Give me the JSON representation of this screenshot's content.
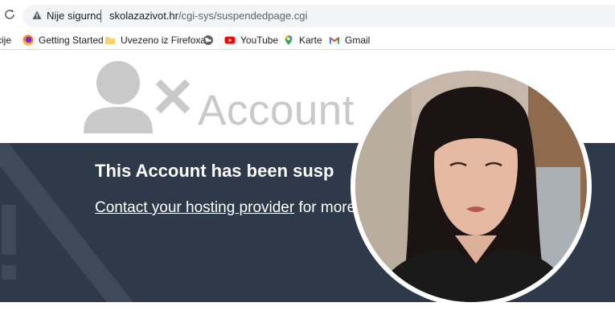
{
  "browser": {
    "security_label": "Nije sigurno",
    "url_host": "skolazazivot.hr",
    "url_path": "/cgi-sys/suspendedpage.cgi"
  },
  "bookmarks": [
    {
      "label": "cije",
      "icon": "apps-icon"
    },
    {
      "label": "Getting Started",
      "icon": "firefox-icon"
    },
    {
      "label": "Uvezeno iz Firefoxa",
      "icon": "folder-icon"
    },
    {
      "label": "",
      "icon": "globe-icon"
    },
    {
      "label": "YouTube",
      "icon": "youtube-icon"
    },
    {
      "label": "Karte",
      "icon": "maps-icon"
    },
    {
      "label": "Gmail",
      "icon": "gmail-icon"
    }
  ],
  "page": {
    "heading_word": "Account",
    "band_title": "This Account has been susp",
    "contact_link": "Contact your hosting provider",
    "contact_rest": " for more in"
  },
  "colors": {
    "band": "#2e3a4a",
    "icon_gray": "#c9c9c9",
    "youtube": "#ff0000"
  }
}
